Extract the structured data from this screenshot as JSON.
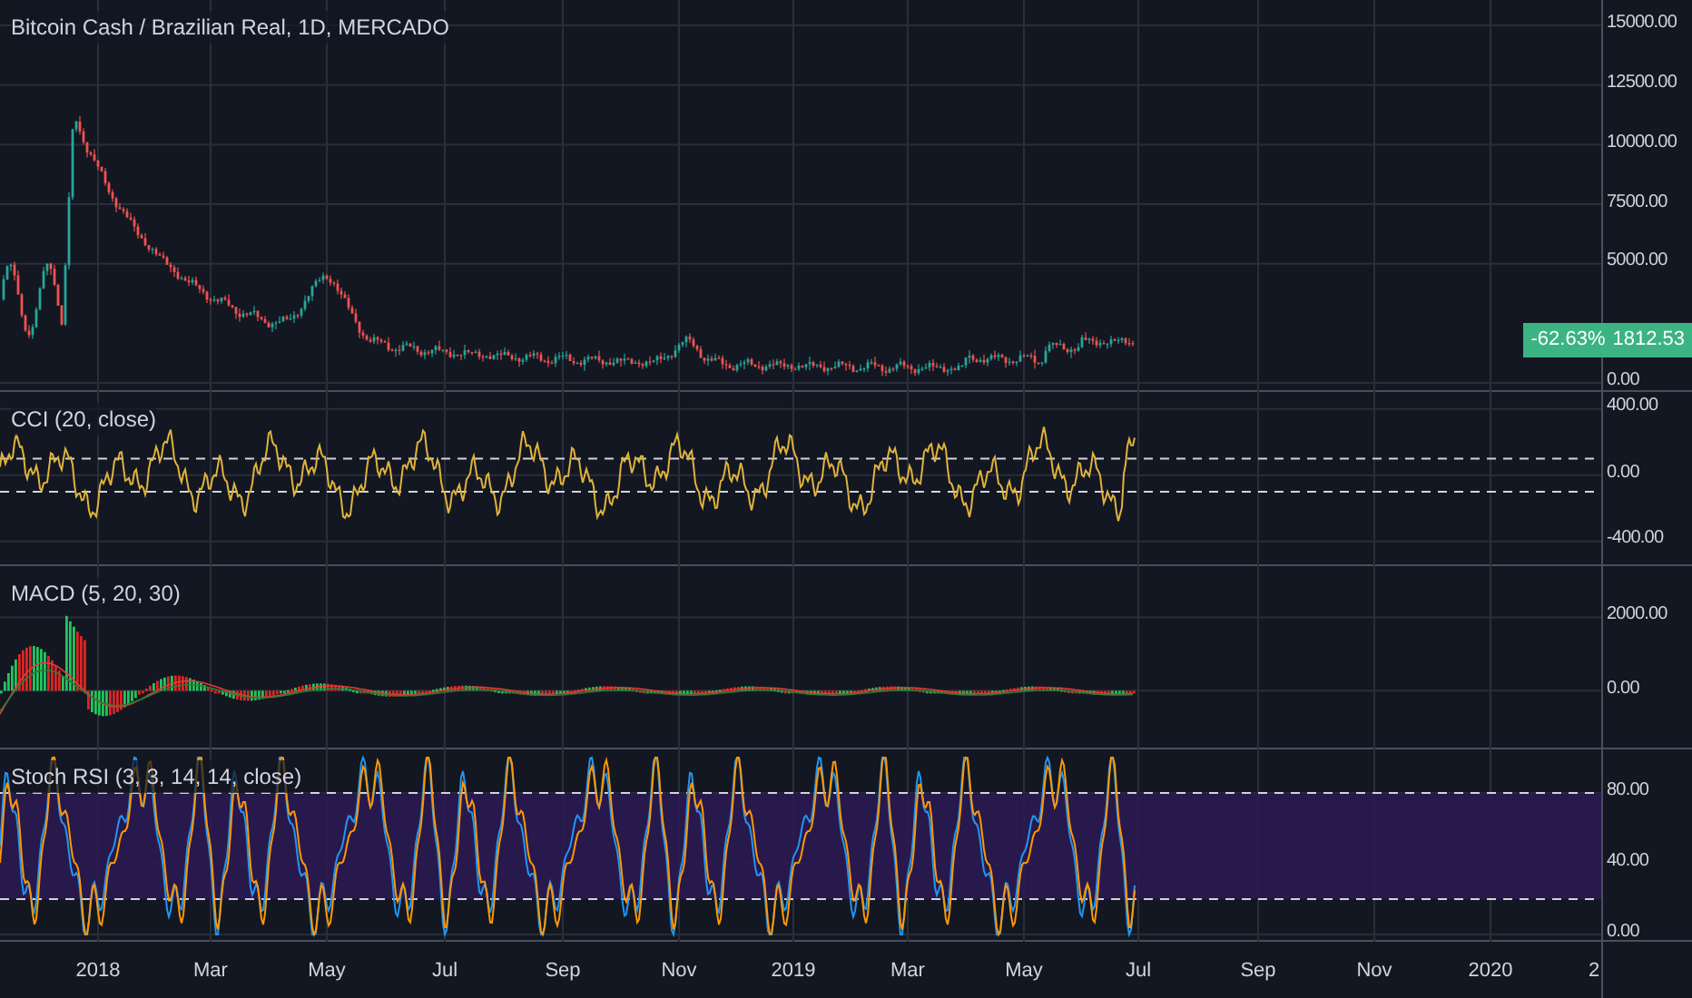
{
  "panes": [
    {
      "kind": "candles",
      "legend": "Bitcoin Cash / Brazilian Real, 1D, MERCADO",
      "ticks": [
        "15000.00",
        "12500.00",
        "10000.00",
        "7500.00",
        "5000.00",
        "0.00"
      ],
      "badge": {
        "change": "-62.63%",
        "price": "1812.53"
      }
    },
    {
      "kind": "cci",
      "legend": "CCI (20, close)",
      "ticks": [
        "400.00",
        "0.00",
        "-400.00"
      ]
    },
    {
      "kind": "macd",
      "legend": "MACD (5, 20, 30)",
      "ticks": [
        "2000.00",
        "0.00"
      ]
    },
    {
      "kind": "stoch",
      "legend": "Stoch RSI (3, 3, 14, 14, close)",
      "ticks": [
        "80.00",
        "40.00",
        "0.00"
      ]
    }
  ],
  "time_axis": [
    "2018",
    "Mar",
    "May",
    "Jul",
    "Sep",
    "Nov",
    "2019",
    "Mar",
    "May",
    "Jul",
    "Sep",
    "Nov",
    "2020",
    "2"
  ]
}
